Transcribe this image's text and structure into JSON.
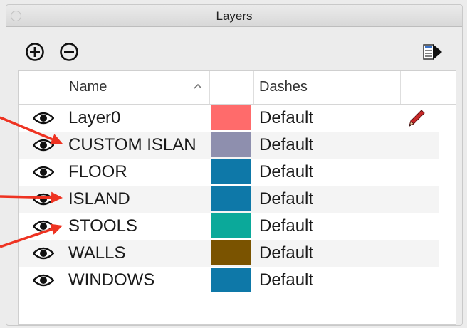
{
  "window": {
    "title": "Layers"
  },
  "toolbar": {
    "add_icon": "plus-circle-icon",
    "remove_icon": "minus-circle-icon",
    "details_icon": "details-arrow-icon"
  },
  "table": {
    "columns": {
      "name": "Name",
      "dashes": "Dashes"
    },
    "sort": "ascending",
    "rows": [
      {
        "name": "Layer0",
        "color": "#ff6b6b",
        "dashes": "Default",
        "active": true
      },
      {
        "name": "CUSTOM ISLAN",
        "color": "#8e8fae",
        "dashes": "Default",
        "active": false
      },
      {
        "name": "FLOOR",
        "color": "#0e78a8",
        "dashes": "Default",
        "active": false
      },
      {
        "name": "ISLAND",
        "color": "#0e78a8",
        "dashes": "Default",
        "active": false
      },
      {
        "name": "STOOLS",
        "color": "#0ba99a",
        "dashes": "Default",
        "active": false
      },
      {
        "name": "WALLS",
        "color": "#7a5300",
        "dashes": "Default",
        "active": false
      },
      {
        "name": "WINDOWS",
        "color": "#0e78a8",
        "dashes": "Default",
        "active": false
      }
    ]
  },
  "annotations": {
    "arrow_color": "#ee3322"
  }
}
